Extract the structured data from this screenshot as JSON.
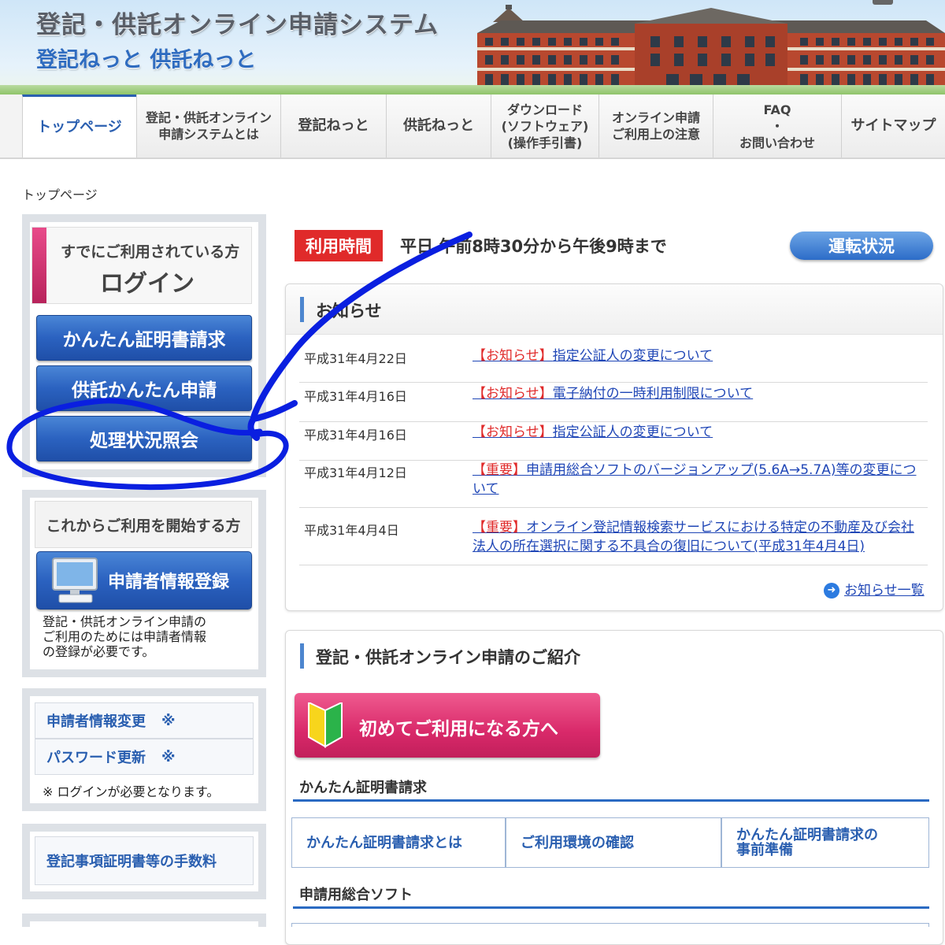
{
  "header": {
    "title": "登記・供託オンライン申請システム",
    "subtitle": "登記ねっと 供託ねっと"
  },
  "nav": {
    "items": [
      {
        "label": "トップページ"
      },
      {
        "label": "登記・供託オンライン\n申請システムとは"
      },
      {
        "label": "登記ねっと"
      },
      {
        "label": "供託ねっと"
      },
      {
        "label": "ダウンロード\n(ソフトウェア)\n(操作手引書)"
      },
      {
        "label": "オンライン申請\nご利用上の注意"
      },
      {
        "label": "FAQ\n・\nお問い合わせ"
      },
      {
        "label": "サイトマップ"
      }
    ]
  },
  "breadcrumb": "トップページ",
  "login": {
    "caption": "すでにご利用されている方",
    "title": "ログイン",
    "buttons": [
      "かんたん証明書請求",
      "供託かんたん申請",
      "処理状況照会"
    ]
  },
  "new_user": {
    "caption": "これからご利用を開始する方",
    "register_label": "申請者情報登録",
    "note": "登記・供託オンライン申請の\nご利用のためには申請者情報\nの登録が必要です。"
  },
  "account": {
    "links": [
      "申請者情報変更",
      "パスワード更新"
    ],
    "mark": "※",
    "note": "※ ログインが必要となります。"
  },
  "fees_link": "登記事項証明書等の手数料",
  "hours": {
    "badge": "利用時間",
    "text": "平日 午前8時30分から午後9時まで",
    "status_button": "運転状況"
  },
  "news": {
    "title": "お知らせ",
    "items": [
      {
        "date": "平成31年4月22日",
        "tag": "【お知らせ】",
        "text": "指定公証人の変更について"
      },
      {
        "date": "平成31年4月16日",
        "tag": "【お知らせ】",
        "text": "電子納付の一時利用制限について"
      },
      {
        "date": "平成31年4月16日",
        "tag": "【お知らせ】",
        "text": "指定公証人の変更について"
      },
      {
        "date": "平成31年4月12日",
        "tag": "【重要】",
        "text": "申請用総合ソフトのバージョンアップ(5.6A→5.7A)等の変更について"
      },
      {
        "date": "平成31年4月4日",
        "tag": "【重要】",
        "text": "オンライン登記情報検索サービスにおける特定の不動産及び会社法人の所在選択に関する不具合の復旧について(平成31年4月4日)"
      }
    ],
    "more": "お知らせ一覧"
  },
  "intro": {
    "title": "登記・供託オンライン申請のご紹介",
    "first_time_button": "初めてご利用になる方へ",
    "section1": "かんたん証明書請求",
    "tiles": [
      "かんたん証明書請求とは",
      "ご利用環境の確認",
      "かんたん証明書請求の\n事前準備"
    ],
    "section2": "申請用総合ソフト"
  },
  "colors": {
    "accent": "#2a5fb0",
    "news_tag": "#e02a2a",
    "login_bar": "#c8306b",
    "annotation": "#0a1fe0"
  }
}
